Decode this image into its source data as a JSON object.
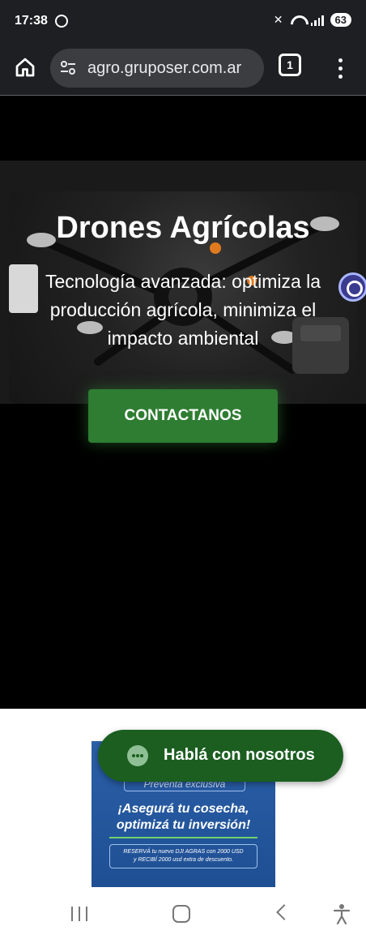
{
  "status_bar": {
    "time": "17:38",
    "battery": "63",
    "icons": [
      "whatsapp-icon",
      "mute-icon",
      "wifi-icon",
      "signal-icon"
    ]
  },
  "browser": {
    "url": "agro.gruposer.com.ar",
    "tab_count": "1",
    "icons": [
      "home-icon",
      "site-settings-icon",
      "more-vert-icon"
    ]
  },
  "hero": {
    "title": "Drones Agrícolas",
    "subtitle": "Tecnología avanzada: optimiza la producción agrícola, minimiza el impacto ambiental",
    "cta_label": "CONTACTANOS"
  },
  "promo": {
    "badge": "Preventa exclusiva",
    "title_line1": "¡Asegurá tu cosecha,",
    "title_line2": "optimizá tu inversión!",
    "box_line1": "RESERVÁ tu nuevo DJI AGRAS con 2000 USD",
    "box_line2": "y RECIBÍ 2000 usd extra de descuento."
  },
  "chat": {
    "label": "Hablá con nosotros"
  },
  "colors": {
    "accent_green": "#2e7d32",
    "chat_green": "#1b5e20",
    "browser_bg": "#1e1f22",
    "promo_blue": "#2a5fa8"
  },
  "nav": {
    "icons": [
      "recents-icon",
      "home-nav-icon",
      "back-icon",
      "accessibility-icon"
    ]
  }
}
